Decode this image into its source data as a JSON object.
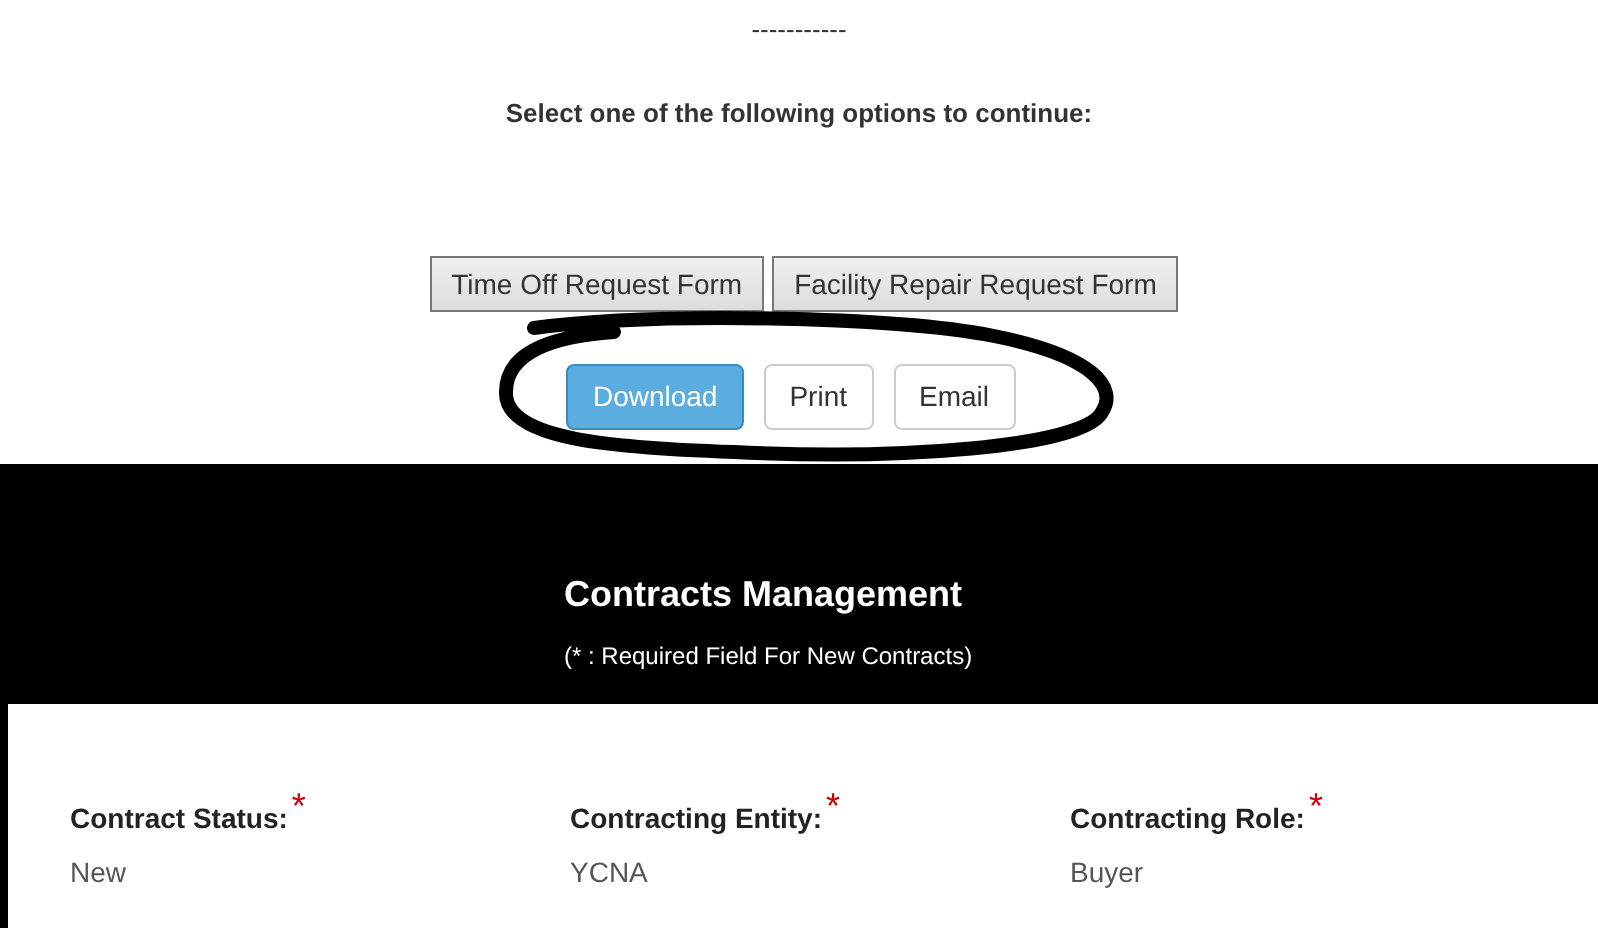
{
  "separator": "-----------",
  "prompt": "Select one of the following options to continue:",
  "form_buttons": [
    "Time Off Request Form",
    "Facility Repair Request Form"
  ],
  "action_buttons": [
    {
      "label": "Download",
      "kind": "primary"
    },
    {
      "label": "Print",
      "kind": "default"
    },
    {
      "label": "Email",
      "kind": "default"
    }
  ],
  "header": {
    "title": "Contracts Management",
    "subtitle": "(* : Required Field For New Contracts)"
  },
  "fields": [
    {
      "label": "Contract Status:",
      "required_mark": "*",
      "value": "New"
    },
    {
      "label": "Contracting Entity:",
      "required_mark": "*",
      "value": "YCNA"
    },
    {
      "label": "Contracting Role:",
      "required_mark": "*",
      "value": "Buyer"
    }
  ]
}
